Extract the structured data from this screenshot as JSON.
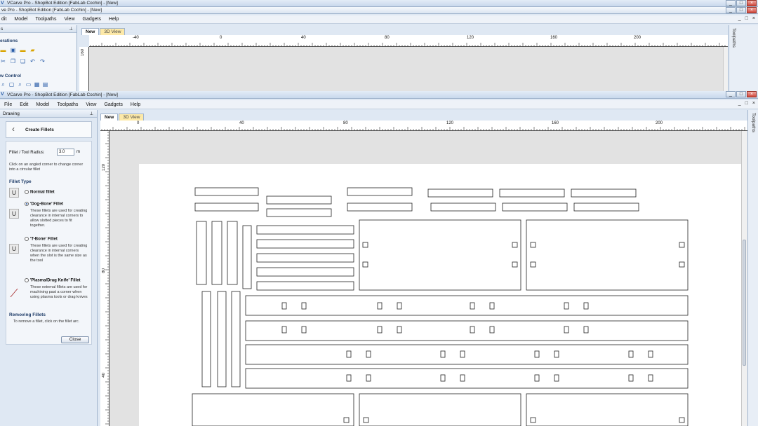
{
  "back_window": {
    "title": "VCarve Pro - ShopBot Edition [FabLab Cochin] - [New]",
    "inner_title": "ve Pro - ShopBot Edition [FabLab Cochin] - [New]",
    "menu": [
      "dit",
      "Model",
      "Toolpaths",
      "View",
      "Gadgets",
      "Help"
    ],
    "panel_label": "s",
    "operations_label": "erations",
    "view_control_label": "w Control",
    "tabs": [
      "New",
      "3D View"
    ],
    "ruler_top": [
      "-40",
      "0",
      "40",
      "80",
      "120",
      "160",
      "200"
    ],
    "ruler_left": [
      "160"
    ],
    "toolpaths_label": "Toolpaths"
  },
  "front_window": {
    "title": "VCarve Pro - ShopBot Edition [FabLab Cochin] - [New]",
    "menu": [
      "File",
      "Edit",
      "Model",
      "Toolpaths",
      "View",
      "Gadgets",
      "Help"
    ],
    "panel_label": "Drawing",
    "tabs": [
      "New",
      "3D View"
    ],
    "ruler_top": [
      "0",
      "40",
      "80",
      "120",
      "160",
      "200"
    ],
    "ruler_left": [
      "120",
      "80",
      "40"
    ],
    "toolpaths_label": "Toolpaths"
  },
  "fillet_form": {
    "heading": "Create Fillets",
    "radius_label": "Fillet / Tool Radius:",
    "radius_value": "3.0",
    "radius_unit": "m",
    "instruction": "Click on an angled corner to change corner into a circular fillet",
    "type_heading": "Fillet Type",
    "options": [
      {
        "label": "Normal fillet",
        "desc": "",
        "selected": false
      },
      {
        "label": "'Dog-Bone' Fillet",
        "desc": "These fillets are used for creating clearance in internal corners to allow slotted pieces to fit together.",
        "selected": true
      },
      {
        "label": "'T-Bone' Fillet",
        "desc": "These fillets are used for creating clearance in internal corners when the slot is the same size as the tool",
        "selected": false
      },
      {
        "label": "'Plasma/Drag Knife' Fillet",
        "desc": "These external fillets are used for machining past a corner when using plasma tools or drag knives",
        "selected": false
      }
    ],
    "removing_heading": "Removing Fillets",
    "removing_desc": "To remove a fillet, click on the fillet arc.",
    "close_label": "Close"
  },
  "window_buttons": [
    "_",
    "□",
    "×"
  ],
  "mdi_buttons": [
    "_",
    "□",
    "×"
  ]
}
